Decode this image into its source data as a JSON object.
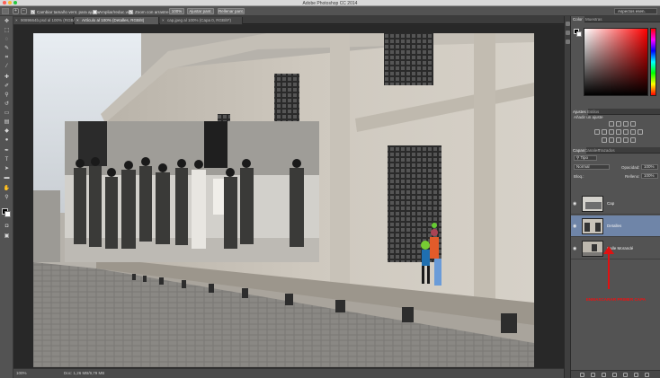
{
  "window": {
    "title": "Adobe Photoshop CC 2014"
  },
  "options_bar": {
    "check_resize": "Cambiar tamaño vent. para ajustar",
    "check_all_windows": "Ampliar/reduc.vent.",
    "check_scrubby": "Zoom con arrastre",
    "percent_button": "100%",
    "fit_button": "Ajustar pant.",
    "fill_button": "Rellenar pant.",
    "workspace": "Aspectos esen."
  },
  "tabs": [
    {
      "label": "9089664b.psd al 100% (RGB/8)",
      "active": false
    },
    {
      "label": "Artículo al 100% (Detalles, RGB/8)",
      "active": true
    },
    {
      "label": "cap.jpeg al 100% (Capa 0, RGB/8*)",
      "active": false
    }
  ],
  "status": {
    "zoom": "100%",
    "doc_info": "Doc: 1,26 MB/9,79 MB"
  },
  "panels": {
    "color_tabs": [
      "Color",
      "Muestras"
    ],
    "adj_tabs": [
      "Ajustes",
      "Estilos"
    ],
    "adj_title": "Añadir un ajuste",
    "layer_tabs": [
      "Capas",
      "Canales",
      "Trazados"
    ],
    "kind": "Tipo",
    "blend_mode": "Normal",
    "opacity_label": "Opacidad:",
    "opacity_value": "100%",
    "fill_label": "Relleno:",
    "fill_value": "100%",
    "lock_label": "Bloq.:"
  },
  "layers": [
    {
      "name": "Cap",
      "selected": false
    },
    {
      "name": "Detalles",
      "selected": true
    },
    {
      "name": "Calle Morandé",
      "selected": false
    }
  ],
  "annotation": {
    "text": "ENMASCARAR PRIMER CAPA",
    "color": "#e11111"
  },
  "colors": {
    "ui_dark": "#535353",
    "selection": "#6f85a8"
  }
}
